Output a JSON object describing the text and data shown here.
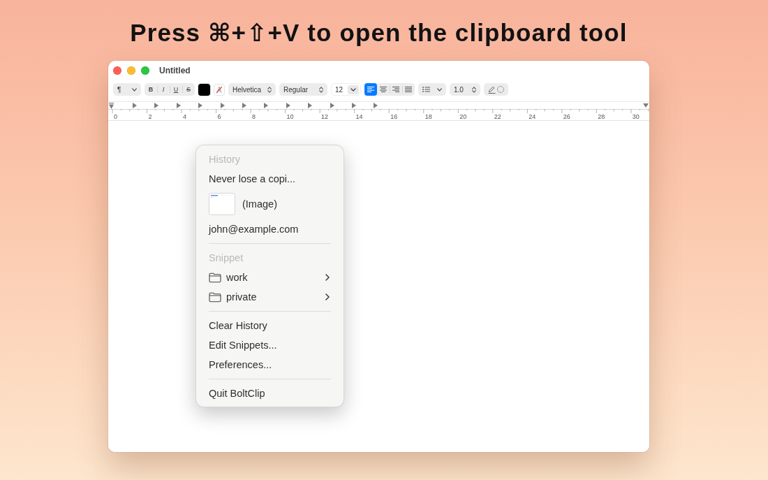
{
  "headline": "Press ⌘+⇧+V to open the clipboard tool",
  "window": {
    "title": "Untitled",
    "toolbar": {
      "paragraph_style": "¶",
      "text_styles": [
        {
          "kind": "bold",
          "label": "B"
        },
        {
          "kind": "italic",
          "label": "I"
        },
        {
          "kind": "underline",
          "label": "U"
        },
        {
          "kind": "strikethrough",
          "label": "S"
        }
      ],
      "text_color": {
        "color": "#000000"
      },
      "font_family": "Helvetica",
      "font_style": "Regular",
      "font_size": "12",
      "alignment": [
        {
          "kind": "left",
          "selected": true
        },
        {
          "kind": "center",
          "selected": false
        },
        {
          "kind": "right",
          "selected": false
        },
        {
          "kind": "justify",
          "selected": false
        }
      ],
      "line_spacing": "1.0"
    },
    "ruler": {
      "labels": [
        "0",
        "2",
        "4",
        "6",
        "8",
        "10",
        "12",
        "14",
        "16",
        "18",
        "20",
        "22",
        "24",
        "26",
        "28",
        "30"
      ]
    }
  },
  "menu": {
    "sections": [
      {
        "header": "History",
        "items": [
          {
            "kind": "text",
            "label": "Never lose a copi..."
          },
          {
            "kind": "image",
            "label": "(Image)"
          },
          {
            "kind": "text",
            "label": "john@example.com"
          }
        ]
      },
      {
        "header": "Snippet",
        "items": [
          {
            "kind": "folder",
            "label": "work",
            "submenu": true
          },
          {
            "kind": "folder",
            "label": "private",
            "submenu": true
          }
        ]
      },
      {
        "items": [
          {
            "kind": "text",
            "label": "Clear History"
          },
          {
            "kind": "text",
            "label": "Edit Snippets..."
          },
          {
            "kind": "text",
            "label": "Preferences..."
          }
        ]
      },
      {
        "items": [
          {
            "kind": "text",
            "label": "Quit BoltClip"
          }
        ]
      }
    ]
  }
}
